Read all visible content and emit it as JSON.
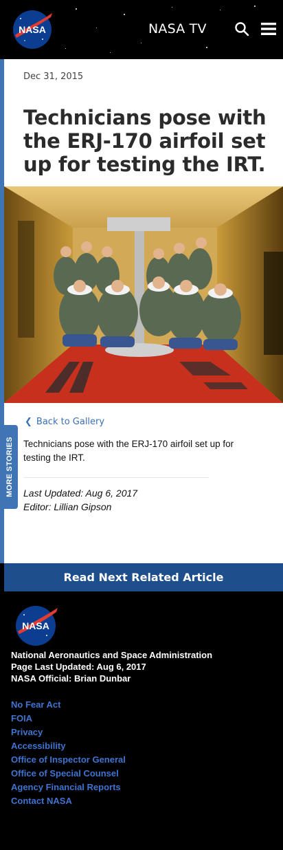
{
  "header": {
    "logo_text": "NASA",
    "nasa_tv_label": "NASA TV"
  },
  "article": {
    "date": "Dec 31, 2015",
    "title": "Technicians pose with the ERJ-170 airfoil set up for testing the IRT.",
    "back_label": "Back to Gallery",
    "caption": "Technicians pose with the ERJ-170 airfoil set up for testing the IRT.",
    "last_updated": "Last Updated: Aug 6, 2017",
    "editor": "Editor: Lillian Gipson"
  },
  "more_stories_label": "MORE STORIES",
  "read_next_label": "Read Next Related Article",
  "footer": {
    "agency_name": "National Aeronautics and Space Administration",
    "page_last_updated": "Page Last Updated: Aug 6, 2017",
    "official": "NASA Official: Brian Dunbar",
    "links": [
      "No Fear Act",
      "FOIA",
      "Privacy",
      "Accessibility",
      "Office of Inspector General",
      "Office of Special Counsel",
      "Agency Financial Reports",
      "Contact NASA"
    ]
  },
  "colors": {
    "accent_blue": "#3f74b5",
    "read_next_blue": "#1e4f8c",
    "link_blue": "#3f74d0",
    "nasa_red": "#e03c31"
  },
  "icons": [
    "nasa-logo",
    "search-icon",
    "menu-icon",
    "chevron-left-icon"
  ]
}
